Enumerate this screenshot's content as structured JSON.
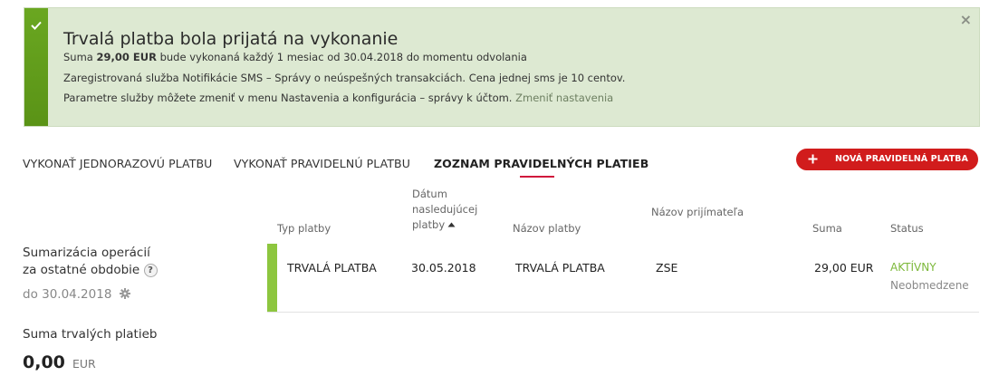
{
  "banner": {
    "title": "Trvalá platba bola prijatá na vykonanie",
    "line1_prefix": "Suma ",
    "line1_amount": "29,00 EUR",
    "line1_suffix": " bude vykonaná každý 1 mesiac od 30.04.2018 do momentu odvolania",
    "line2": "Zaregistrovaná služba Notifikácie SMS – Správy o neúspešných transakciách. Cena jednej sms je 10 centov.",
    "line3_text": "Parametre služby môžete zmeniť v menu Nastavenia a konfigurácia – správy k účtom. ",
    "line3_link": "Zmeniť nastavenia",
    "close": "×",
    "accent_color": "#6aa721"
  },
  "tabs": [
    {
      "label": "VYKONAŤ JEDNORAZOVÚ PLATBU"
    },
    {
      "label": "VYKONAŤ PRAVIDELNÚ PLATBU"
    },
    {
      "label": "ZOZNAM PRAVIDELNÝCH PLATIEB",
      "active": true
    }
  ],
  "new_button": {
    "label": "NOVÁ PRAVIDELNÁ PLATBA",
    "color": "#d11c1c"
  },
  "summary": {
    "label_line1": "Sumarizácia operácií",
    "label_line2": "za ostatné obdobie",
    "help": "?",
    "date": "do 30.04.2018",
    "sum_label": "Suma trvalých platieb",
    "sum_amount": "0,00",
    "sum_currency": "EUR"
  },
  "table": {
    "headers": {
      "type": "Typ platby",
      "date_line1": "Dátum",
      "date_line2": "nasledujúcej",
      "date_line3": "platby",
      "name": "Názov platby",
      "payee": "Názov prijímateľa",
      "sum": "Suma",
      "status": "Status"
    },
    "rows": [
      {
        "type": "TRVALÁ PLATBA",
        "date": "30.05.2018",
        "name": "TRVALÁ PLATBA",
        "payee": "ZSE",
        "sum": "29,00 EUR",
        "status": "AKTÍVNY",
        "limit": "Neobmedzene",
        "status_color": "#7cb83a"
      }
    ]
  }
}
